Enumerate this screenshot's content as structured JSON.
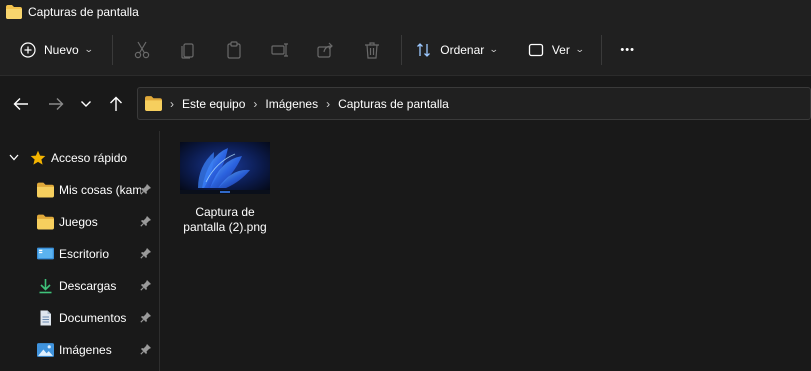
{
  "window": {
    "title": "Capturas de pantalla"
  },
  "commandbar": {
    "new_label": "Nuevo",
    "sort_label": "Ordenar",
    "view_label": "Ver",
    "more_label": "•••"
  },
  "address": {
    "crumbs": [
      "Este equipo",
      "Imágenes",
      "Capturas de pantalla"
    ],
    "separator": "›"
  },
  "sidebar": {
    "quick_access_label": "Acceso rápido",
    "items": [
      {
        "label": "Mis cosas (kam",
        "icon": "folder-icon",
        "pinned": true
      },
      {
        "label": "Juegos",
        "icon": "folder-icon",
        "pinned": true
      },
      {
        "label": "Escritorio",
        "icon": "desktop-icon",
        "pinned": true
      },
      {
        "label": "Descargas",
        "icon": "download-icon",
        "pinned": true
      },
      {
        "label": "Documentos",
        "icon": "document-icon",
        "pinned": true
      },
      {
        "label": "Imágenes",
        "icon": "pictures-icon",
        "pinned": true
      }
    ]
  },
  "files": [
    {
      "name": "Captura de pantalla (2).png",
      "name_line1": "Captura de",
      "name_line2": "pantalla (2).png"
    }
  ],
  "colors": {
    "background": "#191919",
    "toolbar": "#202020",
    "folder": "#f2c24d",
    "star": "#f4b400",
    "accent_blue": "#4aa0ff"
  }
}
